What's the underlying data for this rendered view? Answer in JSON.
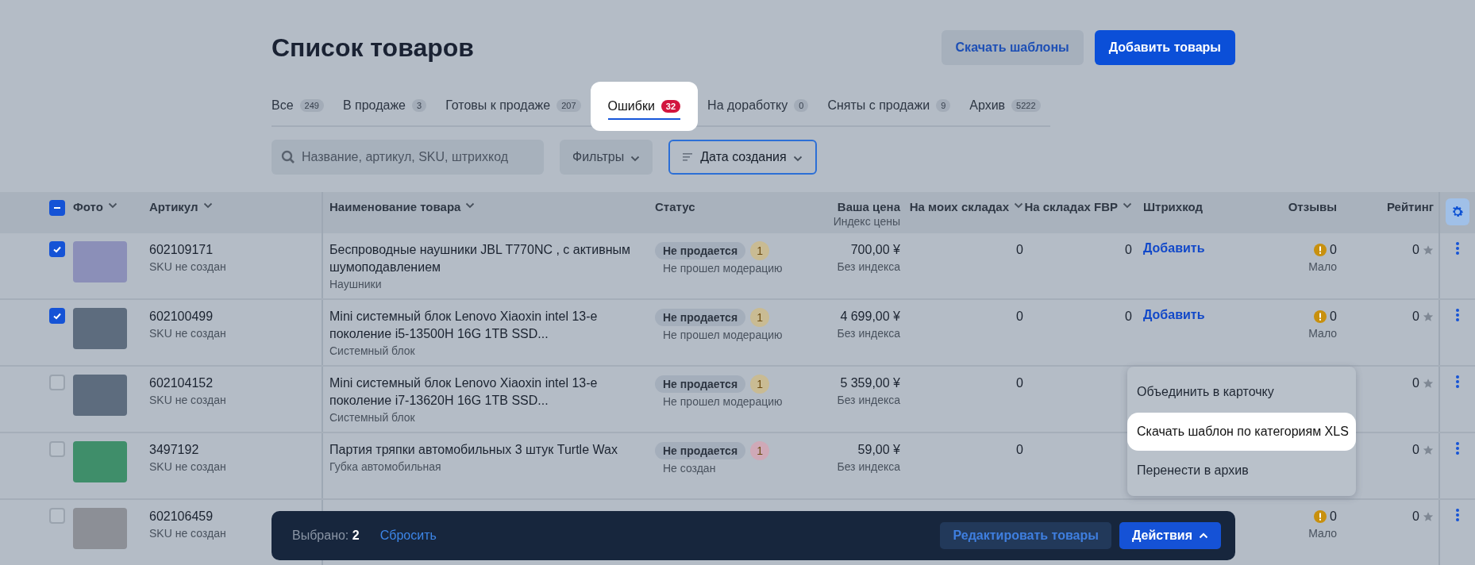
{
  "page": {
    "title": "Список товаров",
    "buttons": [
      {
        "label": "Скачать шаблоны",
        "kind": "secondary"
      },
      {
        "label": "Добавить товары",
        "kind": "primary"
      }
    ]
  },
  "tabs": [
    {
      "label": "Все",
      "count": "249",
      "selected": false
    },
    {
      "label": "В продаже",
      "count": "3",
      "selected": false
    },
    {
      "label": "Готовы к продаже",
      "count": "207",
      "selected": false
    },
    {
      "label": "Ошибки",
      "count": "32",
      "selected": true
    },
    {
      "label": "На доработку",
      "count": "0",
      "selected": false
    },
    {
      "label": "Сняты с продажи",
      "count": "9",
      "selected": false
    },
    {
      "label": "Архив",
      "count": "5222",
      "selected": false
    }
  ],
  "search": {
    "placeholder": "Название, артикул, SKU, штрихкод"
  },
  "filters": {
    "label": "Фильтры"
  },
  "sort": {
    "label": "Дата создания"
  },
  "table": {
    "select_all": {
      "checked": true,
      "partial": true
    },
    "columns": [
      {
        "label": "Фото",
        "sortable": true
      },
      {
        "label": "Артикул",
        "sortable": true
      },
      {
        "label": "Наименование товара",
        "sortable": true
      },
      {
        "label": "Статус",
        "sortable": false
      },
      {
        "label": "Ваша цена",
        "sublabel": "Индекс цены",
        "sortable": false
      },
      {
        "label": "На моих складах",
        "sortable": true
      },
      {
        "label": "На складах FBP",
        "sortable": true
      },
      {
        "label": "Штрихкод",
        "sortable": false
      },
      {
        "label": "Отзывы",
        "sortable": false
      },
      {
        "label": "Рейтинг",
        "sortable": false
      }
    ],
    "rows": [
      {
        "checked": true,
        "article": "602109171",
        "sku": "SKU не создан",
        "name": "Беспроводные наушники JBL T770NC , с активным шумоподавлением",
        "category": "Наушники",
        "status": "Не продается",
        "issues": {
          "count": "1",
          "color": "#c9bb93"
        },
        "status_note": "Не прошел модерацию",
        "price": "700,00 ¥",
        "price_index": "Без индекса",
        "stock": "0",
        "stock_fbp": "0",
        "barcode": "Добавить",
        "reviews": "0",
        "reviews_note": "Мало",
        "rating": "0"
      },
      {
        "checked": true,
        "article": "602100499",
        "sku": "SKU не создан",
        "name": "Mini системный блок Lenovo Xiaoxin intel 13-е поколение i5-13500H 16G 1TB SSD...",
        "category": "Системный блок",
        "status": "Не продается",
        "issues": {
          "count": "1",
          "color": "#c9bb93"
        },
        "status_note": "Не прошел модерацию",
        "price": "4 699,00 ¥",
        "price_index": "Без индекса",
        "stock": "0",
        "stock_fbp": "0",
        "barcode": "Добавить",
        "reviews": "0",
        "reviews_note": "Мало",
        "rating": "0"
      },
      {
        "checked": false,
        "article": "602104152",
        "sku": "SKU не создан",
        "name": "Mini системный блок Lenovo Xiaoxin intel 13-е поколение i7-13620H 16G 1TB SSD...",
        "category": "Системный блок",
        "status": "Не продается",
        "issues": {
          "count": "1",
          "color": "#c9bb93"
        },
        "status_note": "Не прошел модерацию",
        "price": "5 359,00 ¥",
        "price_index": "Без индекса",
        "stock": "0",
        "rating": "0"
      },
      {
        "checked": false,
        "article": "3497192",
        "sku": "SKU не создан",
        "name": "Партия тряпки автомобильных 3 штук Turtle Wax",
        "category": "Губка автомобильная",
        "status": "Не продается",
        "issues": {
          "count": "1",
          "color": "#cfa9b7"
        },
        "status_note": "Не создан",
        "price": "59,00 ¥",
        "price_index": "Без индекса",
        "stock": "0",
        "rating": "0"
      },
      {
        "checked": false,
        "article": "602106459",
        "sku": "SKU не создан",
        "reviews": "0",
        "reviews_note": "Мало",
        "rating": "0"
      }
    ]
  },
  "selection_bar": {
    "count_label": "Выбрано: **2**",
    "reset": "Сбросить",
    "buttons": [
      {
        "label": "Редактировать товары",
        "kind": "secondary"
      },
      {
        "label": "Действия",
        "kind": "primary"
      }
    ]
  },
  "actions_menu": {
    "items": [
      {
        "label": "Объединить в карточку",
        "selected": false
      },
      {
        "label": "Скачать шаблон по категориям XLS",
        "selected": true
      },
      {
        "label": "Перенести в архив",
        "selected": false
      }
    ]
  }
}
